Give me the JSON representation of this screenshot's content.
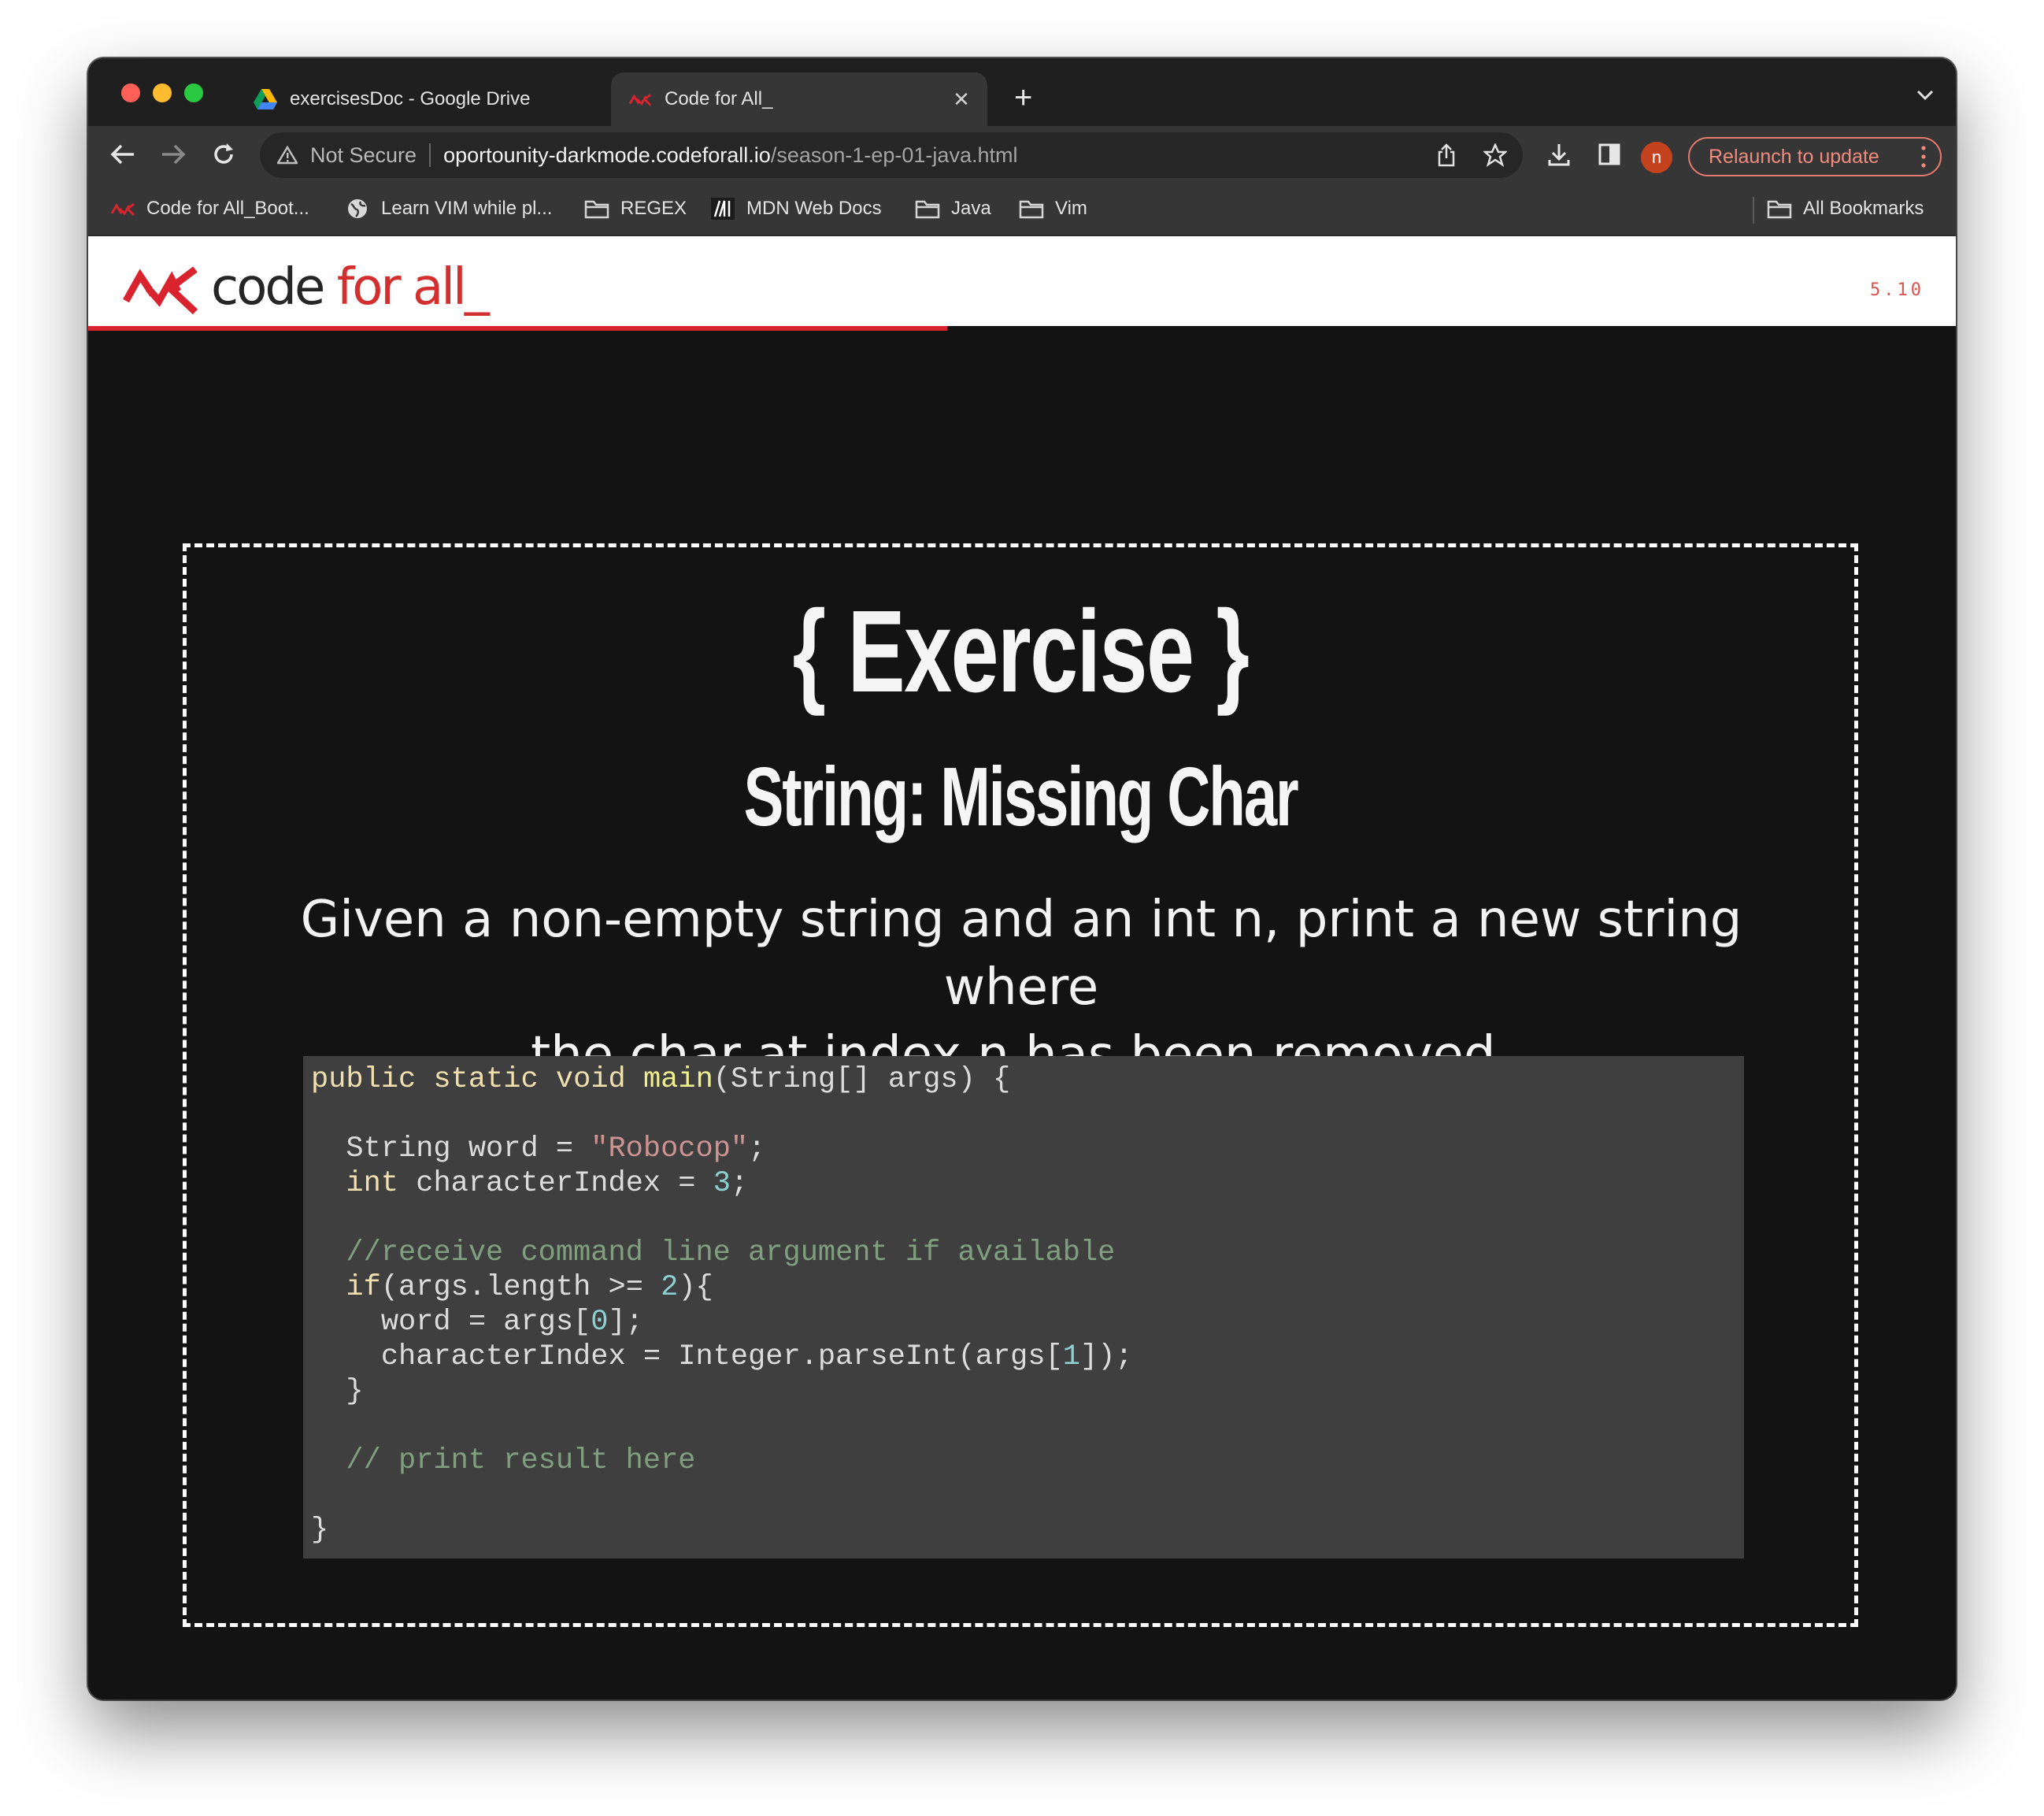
{
  "browser": {
    "tabs": [
      {
        "title": "exercisesDoc - Google Drive",
        "icon": "google-drive-icon",
        "active": false
      },
      {
        "title": "Code for All_",
        "icon": "codeforall-icon",
        "active": true
      }
    ],
    "address": {
      "security_label": "Not Secure",
      "host": "oportounity-darkmode.codeforall.io",
      "path": "/season-1-ep-01-java.html"
    },
    "profile_initial": "n",
    "relaunch_label": "Relaunch to update",
    "bookmarks": [
      {
        "label": "Code for All_Boot...",
        "icon": "codeforall-icon"
      },
      {
        "label": "Learn VIM while pl...",
        "icon": "globe-icon"
      },
      {
        "label": "REGEX",
        "icon": "folder-icon"
      },
      {
        "label": "MDN Web Docs",
        "icon": "mdn-icon"
      },
      {
        "label": "Java",
        "icon": "folder-icon"
      },
      {
        "label": "Vim",
        "icon": "folder-icon"
      }
    ],
    "all_bookmarks_label": "All Bookmarks"
  },
  "site": {
    "logo_code": "code",
    "logo_forall": "for all_",
    "slide_number": "5.10",
    "slide_progress": 0.46,
    "brand_color": "#d9232e"
  },
  "exercise": {
    "heading": "{ Exercise }",
    "title": "String: Missing Char",
    "description_line1": "Given a non-empty string and an int n, print a new string where",
    "description_line2": "the char at index n has been removed.",
    "code_lines": [
      [
        {
          "t": "kw",
          "v": "public"
        },
        {
          "t": "",
          "v": " "
        },
        {
          "t": "kw",
          "v": "static"
        },
        {
          "t": "",
          "v": " "
        },
        {
          "t": "kw",
          "v": "void"
        },
        {
          "t": "",
          "v": " "
        },
        {
          "t": "fn",
          "v": "main"
        },
        {
          "t": "",
          "v": "(String[] args) {"
        }
      ],
      [],
      [
        {
          "t": "",
          "v": "  String word = "
        },
        {
          "t": "str",
          "v": "\"Robocop\""
        },
        {
          "t": "",
          "v": ";"
        }
      ],
      [
        {
          "t": "",
          "v": "  "
        },
        {
          "t": "kw",
          "v": "int"
        },
        {
          "t": "",
          "v": " characterIndex = "
        },
        {
          "t": "num",
          "v": "3"
        },
        {
          "t": "",
          "v": ";"
        }
      ],
      [],
      [
        {
          "t": "cm",
          "v": "  //receive command line argument if available"
        }
      ],
      [
        {
          "t": "",
          "v": "  "
        },
        {
          "t": "kw",
          "v": "if"
        },
        {
          "t": "",
          "v": "(args.length >= "
        },
        {
          "t": "num",
          "v": "2"
        },
        {
          "t": "",
          "v": "){"
        }
      ],
      [
        {
          "t": "",
          "v": "    word = args["
        },
        {
          "t": "num",
          "v": "0"
        },
        {
          "t": "",
          "v": "];"
        }
      ],
      [
        {
          "t": "",
          "v": "    characterIndex = Integer.parseInt(args["
        },
        {
          "t": "num",
          "v": "1"
        },
        {
          "t": "",
          "v": "]);"
        }
      ],
      [
        {
          "t": "",
          "v": "  }"
        }
      ],
      [],
      [
        {
          "t": "cm",
          "v": "  // print result here"
        }
      ],
      [],
      [
        {
          "t": "",
          "v": "}"
        }
      ]
    ]
  }
}
